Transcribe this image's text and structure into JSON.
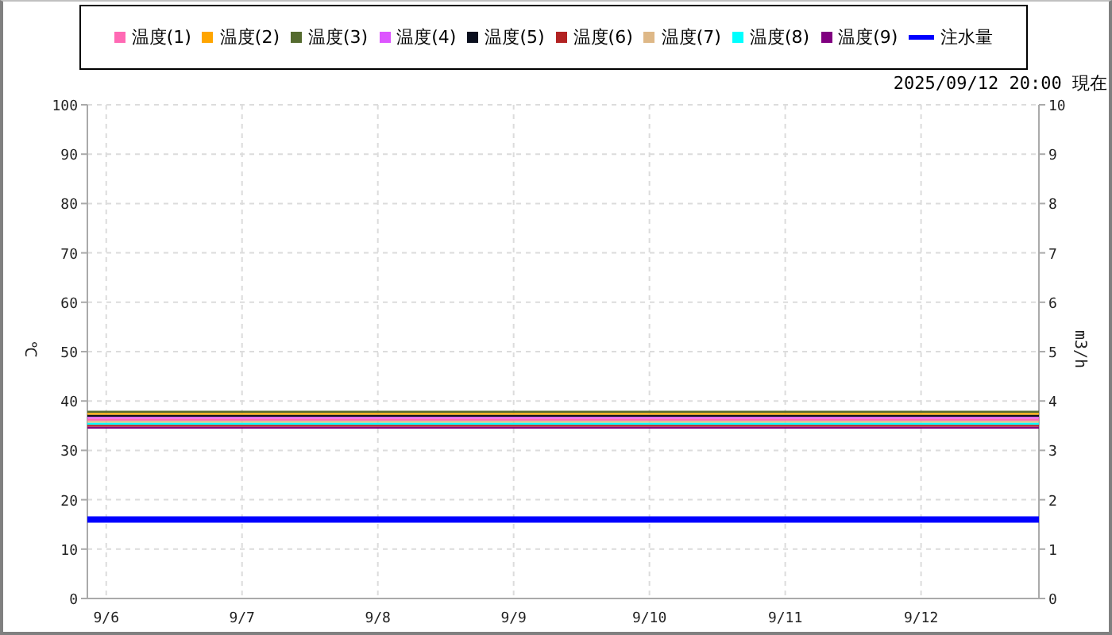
{
  "timestamp": "2025/09/12 20:00 現在",
  "chart_data": {
    "type": "line",
    "grid": true,
    "ylabel": "℃",
    "y2label": "m3/h",
    "xlim": [
      "2025-09-05T20:40",
      "2025-09-12T20:50"
    ],
    "ylim": [
      0,
      100
    ],
    "y2lim": [
      0,
      10
    ],
    "xticks": [
      {
        "value": "2025-09-06",
        "label": "9/6"
      },
      {
        "value": "2025-09-07",
        "label": "9/7"
      },
      {
        "value": "2025-09-08",
        "label": "9/8"
      },
      {
        "value": "2025-09-09",
        "label": "9/9"
      },
      {
        "value": "2025-09-10",
        "label": "9/10"
      },
      {
        "value": "2025-09-11",
        "label": "9/11"
      },
      {
        "value": "2025-09-12",
        "label": "9/12"
      }
    ],
    "yticks": [
      0,
      10,
      20,
      30,
      40,
      50,
      60,
      70,
      80,
      90,
      100
    ],
    "y2ticks": [
      0,
      1,
      2,
      3,
      4,
      5,
      6,
      7,
      8,
      9,
      10
    ],
    "x": [
      "2025-09-05T20:40",
      "2025-09-12T20:50"
    ],
    "series": [
      {
        "name": "温度(1)",
        "color": "#ff69b4",
        "values": [
          36.2,
          36.2
        ]
      },
      {
        "name": "温度(2)",
        "color": "#ffa500",
        "values": [
          37.4,
          37.4
        ]
      },
      {
        "name": "温度(3)",
        "color": "#556b2f",
        "values": [
          37.8,
          37.8
        ]
      },
      {
        "name": "温度(4)",
        "color": "#dd55ff",
        "values": [
          36.6,
          36.6
        ]
      },
      {
        "name": "温度(5)",
        "color": "#0a0f1e",
        "values": [
          37.0,
          37.0
        ]
      },
      {
        "name": "温度(6)",
        "color": "#b22222",
        "values": [
          35.0,
          35.0
        ]
      },
      {
        "name": "温度(7)",
        "color": "#deb887",
        "values": [
          35.8,
          35.8
        ]
      },
      {
        "name": "温度(8)",
        "color": "#00ffff",
        "values": [
          35.4,
          35.4
        ]
      },
      {
        "name": "温度(9)",
        "color": "#800080",
        "values": [
          34.6,
          34.6
        ]
      },
      {
        "name": "注水量",
        "color": "#0000ff",
        "axis": "y2",
        "values": [
          1.6,
          1.6
        ]
      }
    ]
  }
}
